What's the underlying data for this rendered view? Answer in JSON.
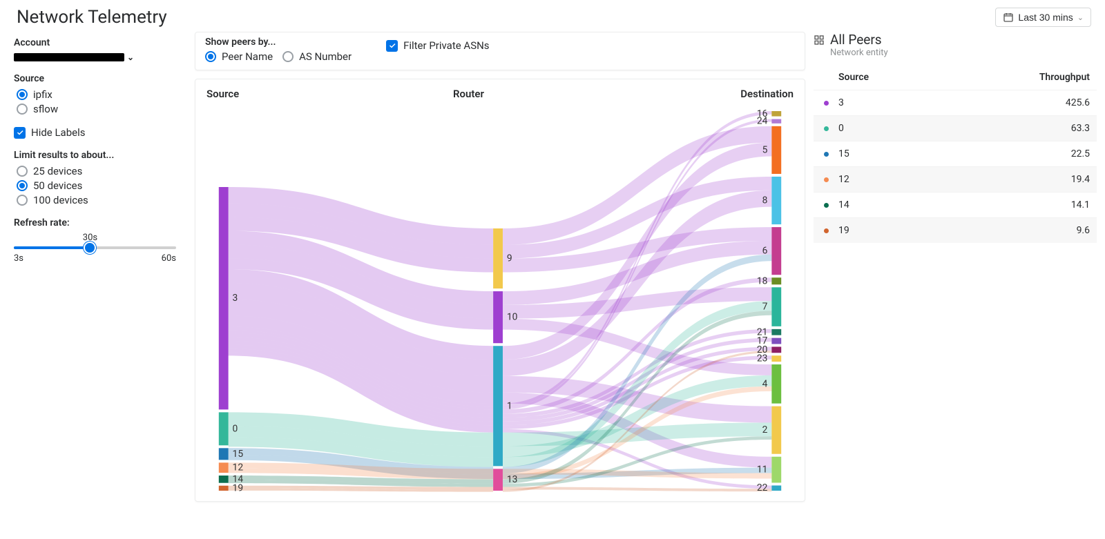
{
  "page_title": "Network Telemetry",
  "time_picker": {
    "label": "Last 30 mins"
  },
  "sidebar": {
    "account_label": "Account",
    "source": {
      "label": "Source",
      "options": [
        "ipfix",
        "sflow"
      ],
      "selected": "ipfix"
    },
    "hide_labels": {
      "label": "Hide Labels",
      "checked": true
    },
    "limit": {
      "label": "Limit results to about...",
      "options": [
        "25 devices",
        "50 devices",
        "100 devices"
      ],
      "selected": "50 devices"
    },
    "refresh": {
      "label": "Refresh rate:",
      "min_label": "3s",
      "max_label": "60s",
      "value_label": "30s",
      "percent": 47
    }
  },
  "filter_bar": {
    "show_peers_label": "Show peers by...",
    "show_peers_options": [
      "Peer Name",
      "AS Number"
    ],
    "show_peers_selected": "Peer Name",
    "filter_private": {
      "label": "Filter Private ASNs",
      "checked": true
    }
  },
  "chart": {
    "headers": {
      "source": "Source",
      "router": "Router",
      "destination": "Destination"
    }
  },
  "chart_data": {
    "type": "sankey",
    "columns": [
      "Source",
      "Router",
      "Destination"
    ],
    "nodes": {
      "Source": [
        {
          "id": "3",
          "value": 425.6,
          "color": "#9e3fd0"
        },
        {
          "id": "0",
          "value": 63.3,
          "color": "#34b79a"
        },
        {
          "id": "15",
          "value": 22.5,
          "color": "#1f77b4"
        },
        {
          "id": "12",
          "value": 19.4,
          "color": "#f58b51"
        },
        {
          "id": "14",
          "value": 14.1,
          "color": "#0b6e4f"
        },
        {
          "id": "19",
          "value": 9.6,
          "color": "#d1642e"
        }
      ],
      "Router": [
        {
          "id": "9",
          "value": 110,
          "color": "#f2c94c"
        },
        {
          "id": "10",
          "value": 95,
          "color": "#9e3fd0"
        },
        {
          "id": "1",
          "value": 220,
          "color": "#2fa9c6"
        },
        {
          "id": "13",
          "value": 40,
          "color": "#e14d9b"
        }
      ],
      "Destination": [
        {
          "id": "16",
          "value": 6,
          "color": "#bfa33a"
        },
        {
          "id": "24",
          "value": 5,
          "color": "#b07bd6"
        },
        {
          "id": "5",
          "value": 55,
          "color": "#f36f21"
        },
        {
          "id": "8",
          "value": 55,
          "color": "#4bc2e6"
        },
        {
          "id": "6",
          "value": 55,
          "color": "#c43d8f"
        },
        {
          "id": "18",
          "value": 8,
          "color": "#6b8e23"
        },
        {
          "id": "7",
          "value": 45,
          "color": "#2bb59b"
        },
        {
          "id": "21",
          "value": 7,
          "color": "#1b7a63"
        },
        {
          "id": "17",
          "value": 7,
          "color": "#7e4fbf"
        },
        {
          "id": "20",
          "value": 7,
          "color": "#8e1f63"
        },
        {
          "id": "23",
          "value": 7,
          "color": "#f2c94c"
        },
        {
          "id": "4",
          "value": 45,
          "color": "#6cbf3f"
        },
        {
          "id": "2",
          "value": 55,
          "color": "#f2c94c"
        },
        {
          "id": "11",
          "value": 30,
          "color": "#9ed86a"
        },
        {
          "id": "22",
          "value": 6,
          "color": "#2fa9c6"
        }
      ]
    },
    "links": [
      {
        "s": "3",
        "r": "9",
        "d": "5",
        "v": 30
      },
      {
        "s": "3",
        "r": "9",
        "d": "8",
        "v": 25
      },
      {
        "s": "3",
        "r": "9",
        "d": "6",
        "v": 25
      },
      {
        "s": "3",
        "r": "10",
        "d": "6",
        "v": 25
      },
      {
        "s": "3",
        "r": "10",
        "d": "7",
        "v": 25
      },
      {
        "s": "3",
        "r": "10",
        "d": "4",
        "v": 20
      },
      {
        "s": "3",
        "r": "1",
        "d": "5",
        "v": 25
      },
      {
        "s": "3",
        "r": "1",
        "d": "8",
        "v": 30
      },
      {
        "s": "3",
        "r": "1",
        "d": "2",
        "v": 30
      },
      {
        "s": "3",
        "r": "1",
        "d": "11",
        "v": 20
      },
      {
        "s": "3",
        "r": "1",
        "d": "16",
        "v": 6
      },
      {
        "s": "3",
        "r": "1",
        "d": "24",
        "v": 5
      },
      {
        "s": "3",
        "r": "1",
        "d": "18",
        "v": 8
      },
      {
        "s": "3",
        "r": "1",
        "d": "21",
        "v": 7
      },
      {
        "s": "3",
        "r": "1",
        "d": "17",
        "v": 7
      },
      {
        "s": "3",
        "r": "1",
        "d": "20",
        "v": 7
      },
      {
        "s": "3",
        "r": "1",
        "d": "23",
        "v": 7
      },
      {
        "s": "3",
        "r": "1",
        "d": "22",
        "v": 6
      },
      {
        "s": "0",
        "r": "1",
        "d": "2",
        "v": 25
      },
      {
        "s": "0",
        "r": "1",
        "d": "4",
        "v": 20
      },
      {
        "s": "0",
        "r": "1",
        "d": "7",
        "v": 18
      },
      {
        "s": "15",
        "r": "1",
        "d": "6",
        "v": 12
      },
      {
        "s": "15",
        "r": "1",
        "d": "11",
        "v": 10
      },
      {
        "s": "12",
        "r": "13",
        "d": "11",
        "v": 10
      },
      {
        "s": "12",
        "r": "13",
        "d": "4",
        "v": 9
      },
      {
        "s": "14",
        "r": "13",
        "d": "7",
        "v": 8
      },
      {
        "s": "14",
        "r": "13",
        "d": "2",
        "v": 6
      },
      {
        "s": "19",
        "r": "13",
        "d": "22",
        "v": 5
      },
      {
        "s": "19",
        "r": "13",
        "d": "20",
        "v": 4
      }
    ]
  },
  "right_panel": {
    "title": "All Peers",
    "subtitle": "Network entity",
    "columns": {
      "source": "Source",
      "throughput": "Throughput"
    },
    "rows": [
      {
        "color": "#9e3fd0",
        "source": "3",
        "throughput": "425.6"
      },
      {
        "color": "#34b79a",
        "source": "0",
        "throughput": "63.3"
      },
      {
        "color": "#1f77b4",
        "source": "15",
        "throughput": "22.5"
      },
      {
        "color": "#f58b51",
        "source": "12",
        "throughput": "19.4"
      },
      {
        "color": "#0b6e4f",
        "source": "14",
        "throughput": "14.1"
      },
      {
        "color": "#d1642e",
        "source": "19",
        "throughput": "9.6"
      }
    ]
  }
}
